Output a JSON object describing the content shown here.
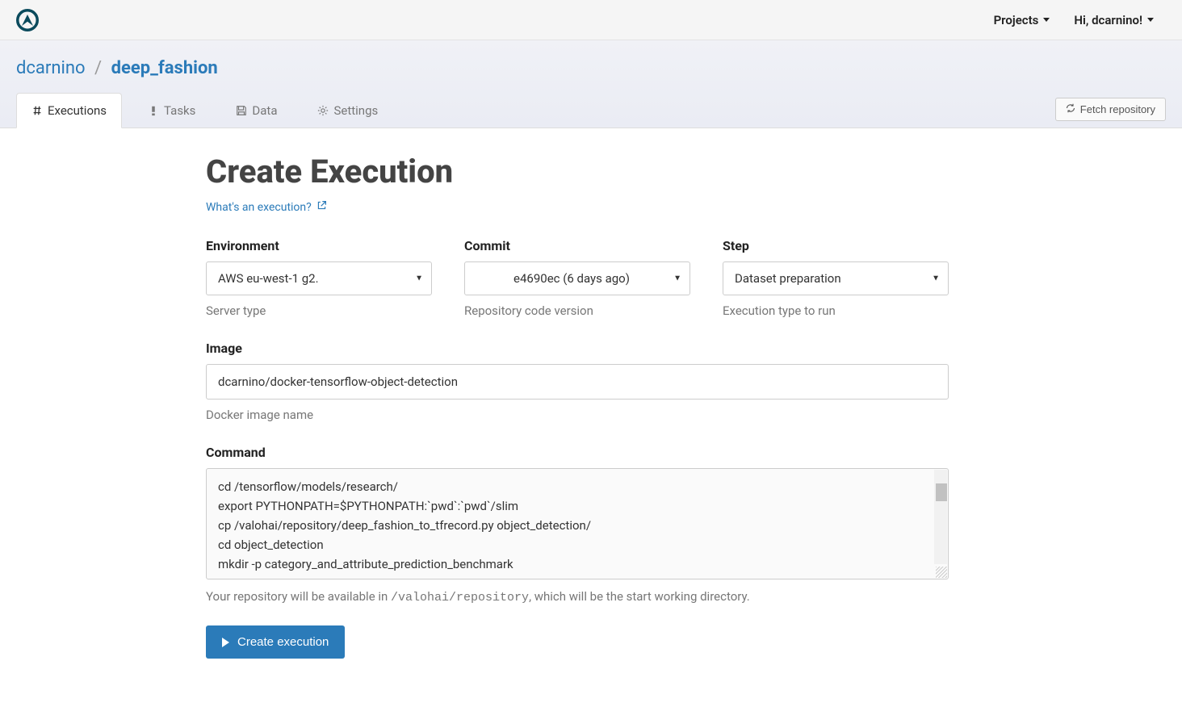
{
  "topbar": {
    "projects_label": "Projects",
    "greeting": "Hi, dcarnino!"
  },
  "breadcrumb": {
    "owner": "dcarnino",
    "project": "deep_fashion"
  },
  "tabs": {
    "executions": "Executions",
    "tasks": "Tasks",
    "data": "Data",
    "settings": "Settings"
  },
  "fetch_button": "Fetch repository",
  "page": {
    "title": "Create Execution",
    "help_link": "What's an execution?"
  },
  "fields": {
    "environment": {
      "label": "Environment",
      "value": "AWS eu-west-1 g2.",
      "helper": "Server type"
    },
    "commit": {
      "label": "Commit",
      "value": "e4690ec (6 days ago)",
      "helper": "Repository code version"
    },
    "step": {
      "label": "Step",
      "value": "Dataset preparation",
      "helper": "Execution type to run"
    },
    "image": {
      "label": "Image",
      "value": "dcarnino/docker-tensorflow-object-detection",
      "helper": "Docker image name"
    },
    "command": {
      "label": "Command",
      "value": "cd /tensorflow/models/research/\nexport PYTHONPATH=$PYTHONPATH:`pwd`:`pwd`/slim\ncp /valohai/repository/deep_fashion_to_tfrecord.py object_detection/\ncd object_detection\nmkdir -p category_and_attribute_prediction_benchmark",
      "note_pre": "Your repository will be available in ",
      "note_code": "/valohai/repository",
      "note_post": ", which will be the start working directory."
    }
  },
  "submit_label": "Create execution"
}
